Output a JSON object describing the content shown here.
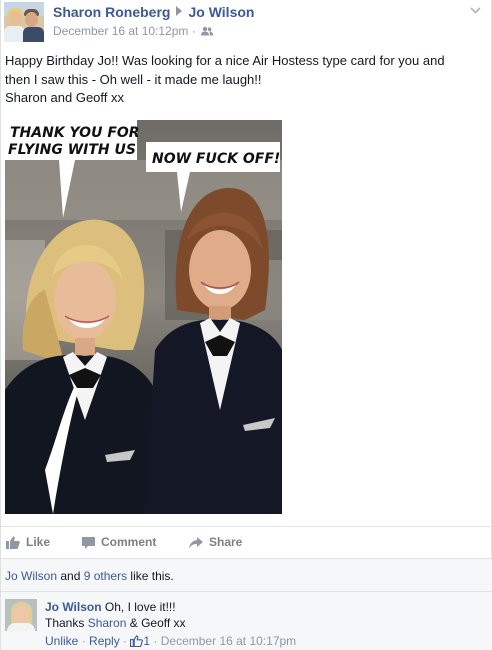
{
  "post": {
    "author": "Sharon Roneberg",
    "recipient": "Jo Wilson",
    "timestamp": "December 16 at 10:12pm",
    "separator": "·",
    "privacy_icon": "friends-icon",
    "message_lines": [
      "Happy Birthday Jo!! Was looking for a nice Air Hostess type card for you and",
      "then I saw this - Oh well - it made me laugh!!",
      "Sharon and Geoff xx"
    ],
    "photo": {
      "bubble_left_line1": "THANK YOU FOR",
      "bubble_left_line2": "FLYING WITH US",
      "bubble_right": "NOW FUCK OFF!"
    }
  },
  "actions": {
    "like": "Like",
    "comment": "Comment",
    "share": "Share"
  },
  "likes": {
    "first": "Jo Wilson",
    "and": " and ",
    "others": "9 others",
    "suffix": " like this."
  },
  "comment": {
    "author": "Jo Wilson",
    "text": " Oh, I love it!!!",
    "reply_prefix": "Thanks ",
    "reply_mention": "Sharon",
    "reply_suffix": " & Geoff xx",
    "unlike": "Unlike",
    "dot": " · ",
    "reply": "Reply",
    "like_count": "1",
    "timestamp": "December 16 at 10:17pm"
  },
  "colors": {
    "link": "#3b5998",
    "muted": "#9197a3"
  }
}
